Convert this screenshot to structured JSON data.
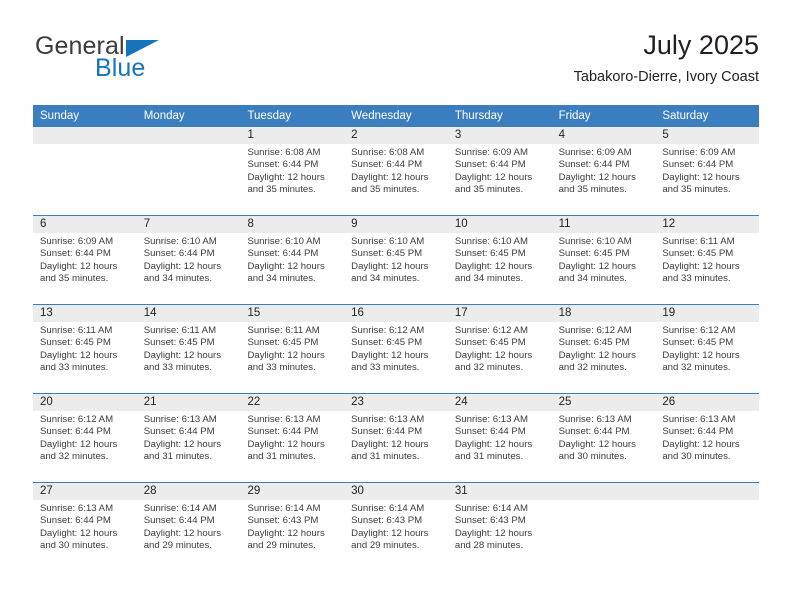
{
  "brand": {
    "name_part1": "General",
    "name_part2": "Blue",
    "flag_icon": "triangle-flag-icon",
    "color_primary": "#1574bb",
    "color_text": "#3c3c3b"
  },
  "header": {
    "title": "July 2025",
    "subtitle": "Tabakoro-Dierre, Ivory Coast"
  },
  "calendar": {
    "accent_color": "#3b7ebf",
    "datebar_color": "#ececec",
    "day_headers": [
      "Sunday",
      "Monday",
      "Tuesday",
      "Wednesday",
      "Thursday",
      "Friday",
      "Saturday"
    ],
    "weeks": [
      {
        "days": [
          {
            "num": "",
            "empty": true,
            "sunrise": "",
            "sunset": "",
            "daylight_line1": "",
            "daylight_line2": ""
          },
          {
            "num": "",
            "empty": true,
            "sunrise": "",
            "sunset": "",
            "daylight_line1": "",
            "daylight_line2": ""
          },
          {
            "num": "1",
            "empty": false,
            "sunrise": "Sunrise: 6:08 AM",
            "sunset": "Sunset: 6:44 PM",
            "daylight_line1": "Daylight: 12 hours",
            "daylight_line2": "and 35 minutes."
          },
          {
            "num": "2",
            "empty": false,
            "sunrise": "Sunrise: 6:08 AM",
            "sunset": "Sunset: 6:44 PM",
            "daylight_line1": "Daylight: 12 hours",
            "daylight_line2": "and 35 minutes."
          },
          {
            "num": "3",
            "empty": false,
            "sunrise": "Sunrise: 6:09 AM",
            "sunset": "Sunset: 6:44 PM",
            "daylight_line1": "Daylight: 12 hours",
            "daylight_line2": "and 35 minutes."
          },
          {
            "num": "4",
            "empty": false,
            "sunrise": "Sunrise: 6:09 AM",
            "sunset": "Sunset: 6:44 PM",
            "daylight_line1": "Daylight: 12 hours",
            "daylight_line2": "and 35 minutes."
          },
          {
            "num": "5",
            "empty": false,
            "sunrise": "Sunrise: 6:09 AM",
            "sunset": "Sunset: 6:44 PM",
            "daylight_line1": "Daylight: 12 hours",
            "daylight_line2": "and 35 minutes."
          }
        ]
      },
      {
        "days": [
          {
            "num": "6",
            "empty": false,
            "sunrise": "Sunrise: 6:09 AM",
            "sunset": "Sunset: 6:44 PM",
            "daylight_line1": "Daylight: 12 hours",
            "daylight_line2": "and 35 minutes."
          },
          {
            "num": "7",
            "empty": false,
            "sunrise": "Sunrise: 6:10 AM",
            "sunset": "Sunset: 6:44 PM",
            "daylight_line1": "Daylight: 12 hours",
            "daylight_line2": "and 34 minutes."
          },
          {
            "num": "8",
            "empty": false,
            "sunrise": "Sunrise: 6:10 AM",
            "sunset": "Sunset: 6:44 PM",
            "daylight_line1": "Daylight: 12 hours",
            "daylight_line2": "and 34 minutes."
          },
          {
            "num": "9",
            "empty": false,
            "sunrise": "Sunrise: 6:10 AM",
            "sunset": "Sunset: 6:45 PM",
            "daylight_line1": "Daylight: 12 hours",
            "daylight_line2": "and 34 minutes."
          },
          {
            "num": "10",
            "empty": false,
            "sunrise": "Sunrise: 6:10 AM",
            "sunset": "Sunset: 6:45 PM",
            "daylight_line1": "Daylight: 12 hours",
            "daylight_line2": "and 34 minutes."
          },
          {
            "num": "11",
            "empty": false,
            "sunrise": "Sunrise: 6:10 AM",
            "sunset": "Sunset: 6:45 PM",
            "daylight_line1": "Daylight: 12 hours",
            "daylight_line2": "and 34 minutes."
          },
          {
            "num": "12",
            "empty": false,
            "sunrise": "Sunrise: 6:11 AM",
            "sunset": "Sunset: 6:45 PM",
            "daylight_line1": "Daylight: 12 hours",
            "daylight_line2": "and 33 minutes."
          }
        ]
      },
      {
        "days": [
          {
            "num": "13",
            "empty": false,
            "sunrise": "Sunrise: 6:11 AM",
            "sunset": "Sunset: 6:45 PM",
            "daylight_line1": "Daylight: 12 hours",
            "daylight_line2": "and 33 minutes."
          },
          {
            "num": "14",
            "empty": false,
            "sunrise": "Sunrise: 6:11 AM",
            "sunset": "Sunset: 6:45 PM",
            "daylight_line1": "Daylight: 12 hours",
            "daylight_line2": "and 33 minutes."
          },
          {
            "num": "15",
            "empty": false,
            "sunrise": "Sunrise: 6:11 AM",
            "sunset": "Sunset: 6:45 PM",
            "daylight_line1": "Daylight: 12 hours",
            "daylight_line2": "and 33 minutes."
          },
          {
            "num": "16",
            "empty": false,
            "sunrise": "Sunrise: 6:12 AM",
            "sunset": "Sunset: 6:45 PM",
            "daylight_line1": "Daylight: 12 hours",
            "daylight_line2": "and 33 minutes."
          },
          {
            "num": "17",
            "empty": false,
            "sunrise": "Sunrise: 6:12 AM",
            "sunset": "Sunset: 6:45 PM",
            "daylight_line1": "Daylight: 12 hours",
            "daylight_line2": "and 32 minutes."
          },
          {
            "num": "18",
            "empty": false,
            "sunrise": "Sunrise: 6:12 AM",
            "sunset": "Sunset: 6:45 PM",
            "daylight_line1": "Daylight: 12 hours",
            "daylight_line2": "and 32 minutes."
          },
          {
            "num": "19",
            "empty": false,
            "sunrise": "Sunrise: 6:12 AM",
            "sunset": "Sunset: 6:45 PM",
            "daylight_line1": "Daylight: 12 hours",
            "daylight_line2": "and 32 minutes."
          }
        ]
      },
      {
        "days": [
          {
            "num": "20",
            "empty": false,
            "sunrise": "Sunrise: 6:12 AM",
            "sunset": "Sunset: 6:44 PM",
            "daylight_line1": "Daylight: 12 hours",
            "daylight_line2": "and 32 minutes."
          },
          {
            "num": "21",
            "empty": false,
            "sunrise": "Sunrise: 6:13 AM",
            "sunset": "Sunset: 6:44 PM",
            "daylight_line1": "Daylight: 12 hours",
            "daylight_line2": "and 31 minutes."
          },
          {
            "num": "22",
            "empty": false,
            "sunrise": "Sunrise: 6:13 AM",
            "sunset": "Sunset: 6:44 PM",
            "daylight_line1": "Daylight: 12 hours",
            "daylight_line2": "and 31 minutes."
          },
          {
            "num": "23",
            "empty": false,
            "sunrise": "Sunrise: 6:13 AM",
            "sunset": "Sunset: 6:44 PM",
            "daylight_line1": "Daylight: 12 hours",
            "daylight_line2": "and 31 minutes."
          },
          {
            "num": "24",
            "empty": false,
            "sunrise": "Sunrise: 6:13 AM",
            "sunset": "Sunset: 6:44 PM",
            "daylight_line1": "Daylight: 12 hours",
            "daylight_line2": "and 31 minutes."
          },
          {
            "num": "25",
            "empty": false,
            "sunrise": "Sunrise: 6:13 AM",
            "sunset": "Sunset: 6:44 PM",
            "daylight_line1": "Daylight: 12 hours",
            "daylight_line2": "and 30 minutes."
          },
          {
            "num": "26",
            "empty": false,
            "sunrise": "Sunrise: 6:13 AM",
            "sunset": "Sunset: 6:44 PM",
            "daylight_line1": "Daylight: 12 hours",
            "daylight_line2": "and 30 minutes."
          }
        ]
      },
      {
        "days": [
          {
            "num": "27",
            "empty": false,
            "sunrise": "Sunrise: 6:13 AM",
            "sunset": "Sunset: 6:44 PM",
            "daylight_line1": "Daylight: 12 hours",
            "daylight_line2": "and 30 minutes."
          },
          {
            "num": "28",
            "empty": false,
            "sunrise": "Sunrise: 6:14 AM",
            "sunset": "Sunset: 6:44 PM",
            "daylight_line1": "Daylight: 12 hours",
            "daylight_line2": "and 29 minutes."
          },
          {
            "num": "29",
            "empty": false,
            "sunrise": "Sunrise: 6:14 AM",
            "sunset": "Sunset: 6:43 PM",
            "daylight_line1": "Daylight: 12 hours",
            "daylight_line2": "and 29 minutes."
          },
          {
            "num": "30",
            "empty": false,
            "sunrise": "Sunrise: 6:14 AM",
            "sunset": "Sunset: 6:43 PM",
            "daylight_line1": "Daylight: 12 hours",
            "daylight_line2": "and 29 minutes."
          },
          {
            "num": "31",
            "empty": false,
            "sunrise": "Sunrise: 6:14 AM",
            "sunset": "Sunset: 6:43 PM",
            "daylight_line1": "Daylight: 12 hours",
            "daylight_line2": "and 28 minutes."
          },
          {
            "num": "",
            "empty": true,
            "sunrise": "",
            "sunset": "",
            "daylight_line1": "",
            "daylight_line2": ""
          },
          {
            "num": "",
            "empty": true,
            "sunrise": "",
            "sunset": "",
            "daylight_line1": "",
            "daylight_line2": ""
          }
        ]
      }
    ]
  }
}
